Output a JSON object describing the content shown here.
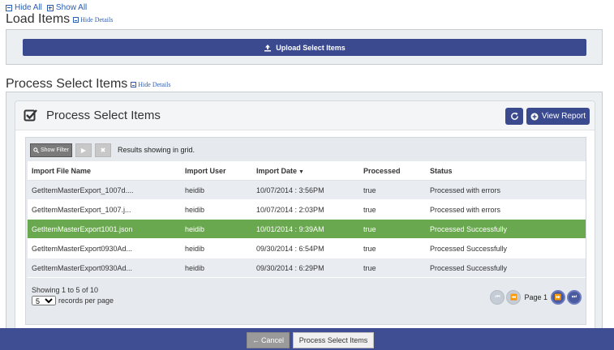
{
  "top_links": {
    "hide_all": "Hide All",
    "show_all": "Show All"
  },
  "load_items": {
    "title": "Load Items",
    "hide_details": "Hide Details",
    "upload_label": "Upload Select Items"
  },
  "process_section": {
    "title": "Process Select Items",
    "hide_details": "Hide Details"
  },
  "card": {
    "title": "Process Select Items",
    "view_report_label": "View Report"
  },
  "toolbar": {
    "show_filter_label": "Show Filter",
    "results_text": "Results showing in grid."
  },
  "table": {
    "headers": [
      "Import File Name",
      "Import User",
      "Import Date",
      "Processed",
      "Status"
    ],
    "rows": [
      {
        "file": "GetItemMasterExport_1007d....",
        "user": "heidib",
        "date": "10/07/2014 : 3:56PM",
        "processed": "true",
        "status": "Processed with errors"
      },
      {
        "file": "GetItemMasterExport_1007.j...",
        "user": "heidib",
        "date": "10/07/2014 : 2:03PM",
        "processed": "true",
        "status": "Processed with errors"
      },
      {
        "file": "GetItemMasterExport1001.json",
        "user": "heidib",
        "date": "10/01/2014 : 9:39AM",
        "processed": "true",
        "status": "Processed Successfully"
      },
      {
        "file": "GetItemMasterExport0930Ad...",
        "user": "heidib",
        "date": "09/30/2014 : 6:54PM",
        "processed": "true",
        "status": "Processed Successfully"
      },
      {
        "file": "GetItemMasterExport0930Ad...",
        "user": "heidib",
        "date": "09/30/2014 : 6:29PM",
        "processed": "true",
        "status": "Processed Successfully"
      }
    ]
  },
  "footer": {
    "showing": "Showing 1 to 5 of 10",
    "per_page_value": "5",
    "per_page_label": "records per page",
    "page_label": "Page 1"
  },
  "bottom": {
    "cancel_label": "Cancel",
    "process_label": "Process Select Items"
  },
  "colors": {
    "primary": "#3b4a8f",
    "selected_row": "#6aa84f",
    "link": "#2a5db0"
  }
}
